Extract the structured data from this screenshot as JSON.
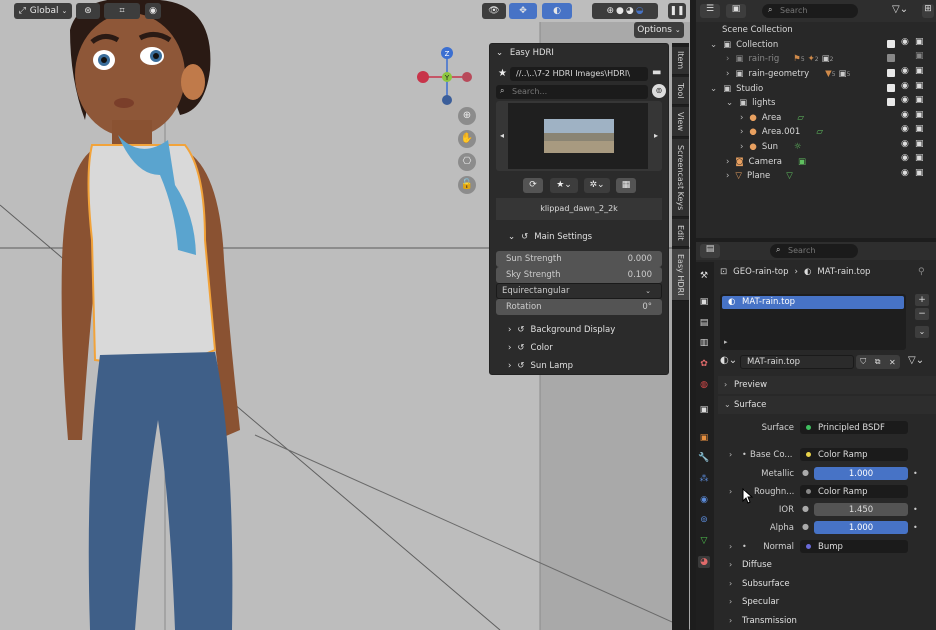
{
  "viewport": {
    "transform_orientation": "Global",
    "options_label": "Options"
  },
  "gizmo": {
    "z": "Z",
    "y": "Y",
    "x": "X"
  },
  "easy_hdri": {
    "panel_title": "Easy HDRI",
    "path": "//..\\..\\7-2 HDRI Images\\HDRI\\",
    "search_placeholder": "Search...",
    "current_hdri": "klippad_dawn_2_2k",
    "main_settings_label": "Main Settings",
    "sun_strength_label": "Sun Strength",
    "sun_strength_value": "0.000",
    "sky_strength_label": "Sky Strength",
    "sky_strength_value": "0.100",
    "projection": "Equirectangular",
    "rotation_label": "Rotation",
    "rotation_value": "0°",
    "background_display_label": "Background Display",
    "color_label": "Color",
    "sun_lamp_label": "Sun Lamp"
  },
  "side_tabs": [
    "Item",
    "Tool",
    "View",
    "Screencast Keys",
    "Edit",
    "Easy HDRI"
  ],
  "outliner": {
    "search_placeholder": "Search",
    "rows": [
      {
        "label": "Scene Collection"
      },
      {
        "label": "Collection"
      },
      {
        "label": "rain-rig",
        "badge1": "5",
        "badge2": "2",
        "badge3": "2"
      },
      {
        "label": "rain-geometry",
        "badge1": "5",
        "badge2": "5"
      },
      {
        "label": "Studio"
      },
      {
        "label": "lights"
      },
      {
        "label": "Area"
      },
      {
        "label": "Area.001"
      },
      {
        "label": "Sun"
      },
      {
        "label": "Camera"
      },
      {
        "label": "Plane"
      }
    ]
  },
  "properties": {
    "search_placeholder": "Search",
    "breadcrumb_object": "GEO-rain-top",
    "breadcrumb_material": "MAT-rain.top",
    "slot_label": "MAT-rain.top",
    "material_name": "MAT-rain.top",
    "preview_label": "Preview",
    "surface_label": "Surface",
    "surface_field_label": "Surface",
    "surface_value": "Principled BSDF",
    "base_color_label": "Base Co...",
    "base_color_value": "Color Ramp",
    "metallic_label": "Metallic",
    "metallic_value": "1.000",
    "roughness_label": "Roughn...",
    "roughness_value": "Color Ramp",
    "ior_label": "IOR",
    "ior_value": "1.450",
    "alpha_label": "Alpha",
    "alpha_value": "1.000",
    "normal_label": "Normal",
    "normal_value": "Bump",
    "diffuse_label": "Diffuse",
    "subsurface_label": "Subsurface",
    "specular_label": "Specular",
    "transmission_label": "Transmission"
  },
  "colors": {
    "accent_blue": "#4773c6",
    "selection_orange": "#f2a33a",
    "viewport_bg": "#bdbdbd"
  }
}
